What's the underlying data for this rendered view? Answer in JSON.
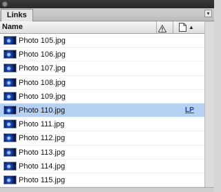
{
  "panel": {
    "tab_label": "Links"
  },
  "columns": {
    "name": "Name"
  },
  "links": [
    {
      "filename": "Photo 105.jpg",
      "status": "",
      "selected": false
    },
    {
      "filename": "Photo 106.jpg",
      "status": "",
      "selected": false
    },
    {
      "filename": "Photo 107.jpg",
      "status": "",
      "selected": false
    },
    {
      "filename": "Photo 108.jpg",
      "status": "",
      "selected": false
    },
    {
      "filename": "Photo 109.jpg",
      "status": "",
      "selected": false
    },
    {
      "filename": "Photo 110.jpg",
      "status": "LP",
      "selected": true
    },
    {
      "filename": "Photo 111.jpg",
      "status": "",
      "selected": false
    },
    {
      "filename": "Photo 112.jpg",
      "status": "",
      "selected": false
    },
    {
      "filename": "Photo 113.jpg",
      "status": "",
      "selected": false
    },
    {
      "filename": "Photo 114.jpg",
      "status": "",
      "selected": false
    },
    {
      "filename": "Photo 115.jpg",
      "status": "",
      "selected": false
    }
  ],
  "colors": {
    "selection": "#b6d0f2",
    "status_link": "#1c3ca8"
  },
  "icons": {
    "close": "close-icon",
    "panel_menu": "panel-menu-icon",
    "warning_column": "warning-icon",
    "page_column": "page-icon",
    "sort": "sort-up-icon",
    "thumbnail": "image-thumbnail-icon"
  }
}
